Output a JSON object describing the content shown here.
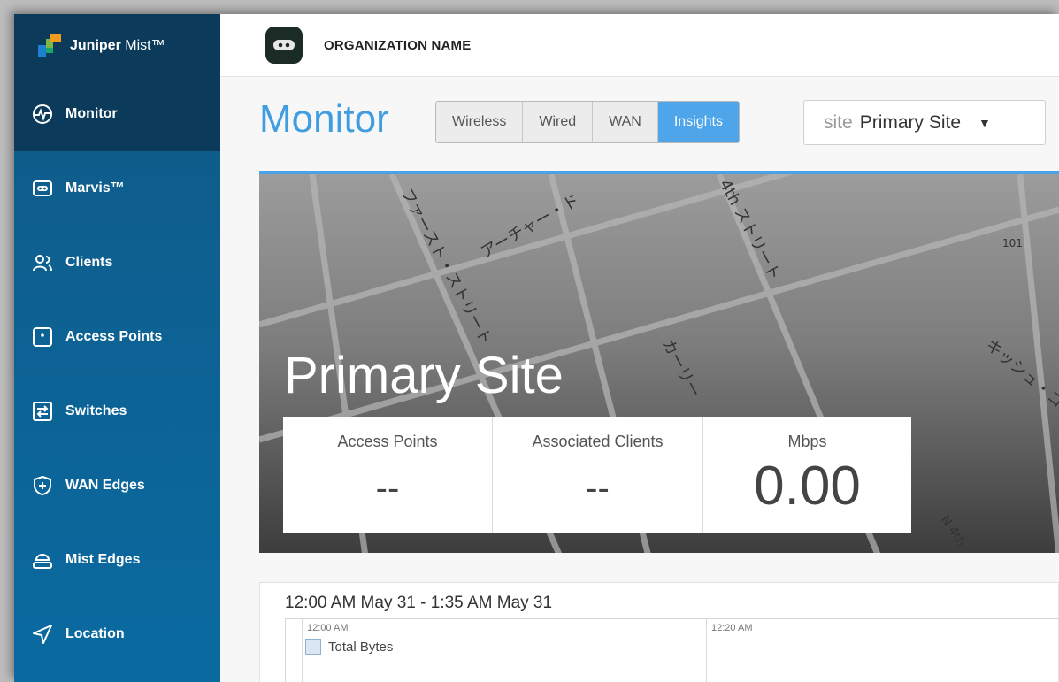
{
  "brand": {
    "name_bold": "Juniper",
    "name_rest": " Mist™"
  },
  "sidebar": {
    "items": [
      {
        "label": "Monitor",
        "icon": "monitor-pulse-icon",
        "active": true
      },
      {
        "label": "Marvis™",
        "icon": "marvis-icon"
      },
      {
        "label": "Clients",
        "icon": "clients-icon"
      },
      {
        "label": "Access Points",
        "icon": "access-point-icon"
      },
      {
        "label": "Switches",
        "icon": "switch-icon"
      },
      {
        "label": "WAN Edges",
        "icon": "wan-edge-icon"
      },
      {
        "label": "Mist Edges",
        "icon": "mist-edge-icon"
      },
      {
        "label": "Location",
        "icon": "location-icon"
      }
    ]
  },
  "header": {
    "org_name": "ORGANIZATION NAME"
  },
  "page": {
    "title": "Monitor"
  },
  "tabs": [
    {
      "label": "Wireless"
    },
    {
      "label": "Wired"
    },
    {
      "label": "WAN"
    },
    {
      "label": "Insights",
      "active": true
    }
  ],
  "site_select": {
    "prefix": "site",
    "value": "Primary Site"
  },
  "hero": {
    "site_name": "Primary Site",
    "map_labels": [
      "ファースト・ストリート",
      "アーチャー・ド",
      "4th ストリート",
      "カーリー",
      "キッシュ・コ",
      "101",
      "N 4th"
    ],
    "stats": [
      {
        "label": "Access Points",
        "value": "--"
      },
      {
        "label": "Associated Clients",
        "value": "--"
      },
      {
        "label": "Mbps",
        "value": "0.00"
      }
    ]
  },
  "chart": {
    "range": "12:00 AM May 31 - 1:35 AM May 31",
    "ticks": [
      "12:00 AM",
      "12:20 AM"
    ],
    "legend": "Total Bytes"
  },
  "colors": {
    "accent": "#4ea5e9",
    "sidebar": "#0f5a87",
    "sidebar_active": "#0b3a5a",
    "title": "#3f9de0"
  }
}
